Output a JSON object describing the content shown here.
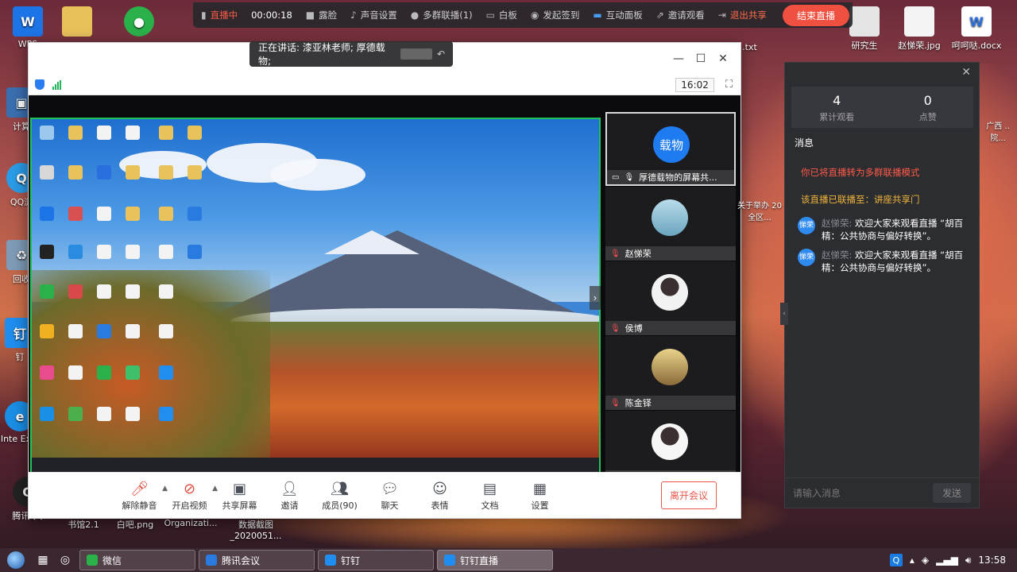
{
  "live_bar": {
    "live_label": "直播中",
    "timer": "00:00:18",
    "items": [
      "露脸",
      "声音设置",
      "多群联播(1)",
      "白板",
      "发起签到",
      "互动面板",
      "邀请观看"
    ],
    "exit_share": "退出共享",
    "end_live": "结束直播"
  },
  "speaker_tip": "正在讲话: 漆亚林老师; 厚德载物;",
  "meeting": {
    "clock": "16:02",
    "tiles": [
      {
        "avatar_text": "载物",
        "name": "厚德载物的屏幕共...",
        "avatar_color": "#1e7bf0"
      },
      {
        "avatar_text": "",
        "name": "赵悌荣",
        "avatar_color": "#86c0d8"
      },
      {
        "avatar_text": "",
        "name": "侯博",
        "avatar_color": "#e8e8e8"
      },
      {
        "avatar_text": "",
        "name": "陈金铎",
        "avatar_color": "#d8c07a"
      },
      {
        "avatar_text": "",
        "name": "",
        "avatar_color": "#f0f0f0"
      }
    ],
    "toolbar": [
      {
        "label": "解除静音",
        "icon": "mic-muted-icon"
      },
      {
        "label": "开启视频",
        "icon": "video-off-icon"
      },
      {
        "label": "共享屏幕",
        "icon": "share-screen-icon"
      },
      {
        "label": "邀请",
        "icon": "invite-icon"
      },
      {
        "label": "成员(90)",
        "icon": "members-icon"
      },
      {
        "label": "聊天",
        "icon": "chat-icon"
      },
      {
        "label": "表情",
        "icon": "emoji-icon"
      },
      {
        "label": "文档",
        "icon": "document-icon"
      },
      {
        "label": "设置",
        "icon": "settings-icon"
      }
    ],
    "leave": "离开会议"
  },
  "chat": {
    "viewers_count": "4",
    "viewers_label": "累计观看",
    "likes_count": "0",
    "likes_label": "点赞",
    "section": "消息",
    "sys1": "你已将直播转为多群联播模式",
    "sys2": "该直播已联播至：讲座共享门",
    "messages": [
      {
        "avatar": "悌荣",
        "user": "赵悌荣:",
        "text": "欢迎大家来观看直播 “胡百精：公共协商与偏好转换”。"
      },
      {
        "avatar": "悌荣",
        "user": "赵悌荣:",
        "text": "欢迎大家来观看直播 “胡百精：公共协商与偏好转换”。"
      }
    ],
    "input_placeholder": "请输入消息",
    "send": "发送"
  },
  "desktop": {
    "icons_left": [
      "WPS",
      "计算",
      "QQ浏",
      "回收",
      "钉",
      "Inte\nExpl",
      "腾讯QQ"
    ],
    "icons_right": [
      "研究生",
      "赵悌荣.jpg",
      "呵呵哒.docx"
    ],
    "bottom_labels": [
      "书馆2.1",
      "白吧.png",
      "Organizati...",
      "数据截图\n_2020051..."
    ],
    "extra": [
      "1.txt",
      "广西\n..院...",
      "关于举办\n20全区..."
    ]
  },
  "taskbar": {
    "tasks": [
      "微信",
      "腾讯会议",
      "钉钉",
      "钉钉直播"
    ],
    "time": "13:58"
  }
}
